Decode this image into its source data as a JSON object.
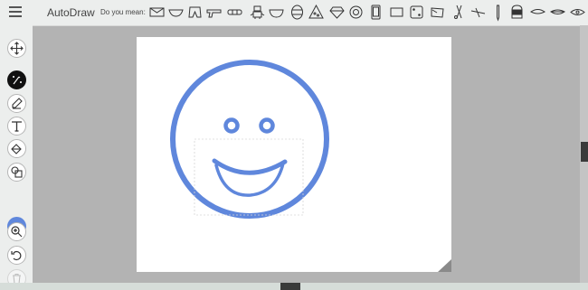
{
  "app": {
    "title": "AutoDraw",
    "suggestion_prompt": "Do you mean:"
  },
  "suggestions": [
    {
      "icon": "box-icon"
    },
    {
      "icon": "bowl-icon"
    },
    {
      "icon": "shorts-icon"
    },
    {
      "icon": "gun-icon"
    },
    {
      "icon": "bandage-icon"
    },
    {
      "icon": "robot-icon"
    },
    {
      "icon": "bowl-half-icon"
    },
    {
      "icon": "easter-egg-icon"
    },
    {
      "icon": "pizza-slice-icon"
    },
    {
      "icon": "diamond-icon"
    },
    {
      "icon": "gear-icon"
    },
    {
      "icon": "phone-icon"
    },
    {
      "icon": "rectangle-icon"
    },
    {
      "icon": "dice-icon"
    },
    {
      "icon": "envelope-icon"
    },
    {
      "icon": "scissors-icon"
    },
    {
      "icon": "plane-icon"
    },
    {
      "icon": "pencil-icon"
    },
    {
      "icon": "helmet-icon"
    },
    {
      "icon": "lips-icon"
    },
    {
      "icon": "lips-icon"
    },
    {
      "icon": "eye-icon"
    }
  ],
  "toolbar": {
    "tools": [
      {
        "name": "move-tool",
        "icon": "move-icon",
        "active": false
      },
      {
        "name": "autodraw-tool",
        "icon": "autodraw-magic-icon",
        "active": true
      },
      {
        "name": "draw-tool",
        "icon": "pencil-icon",
        "active": false
      },
      {
        "name": "type-tool",
        "icon": "text-icon",
        "active": false
      },
      {
        "name": "fill-tool",
        "icon": "paint-bucket-icon",
        "active": false
      },
      {
        "name": "shape-tool",
        "icon": "shapes-icon",
        "active": false
      },
      {
        "name": "zoom-tool",
        "icon": "zoom-icon",
        "active": false
      },
      {
        "name": "undo-tool",
        "icon": "undo-icon",
        "active": false
      },
      {
        "name": "delete-tool",
        "icon": "trash-icon",
        "active": false,
        "disabled": true
      }
    ],
    "current_color": "#5f87dc"
  },
  "colors": {
    "stroke": "#5f87dc",
    "topbar": "#eceeed",
    "workspace": "#b3b3b3"
  }
}
